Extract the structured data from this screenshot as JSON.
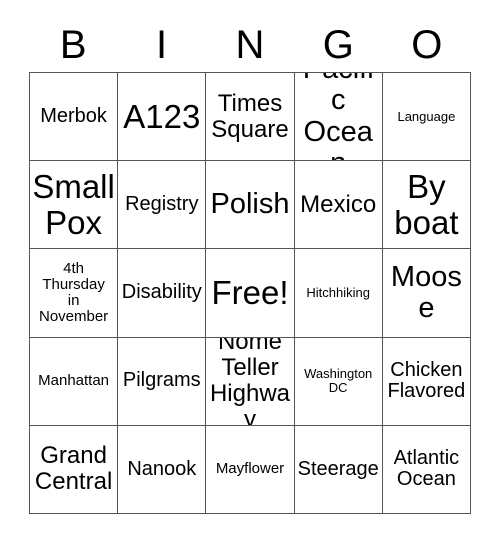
{
  "card": {
    "header": {
      "letters": [
        "B",
        "I",
        "N",
        "G",
        "O"
      ]
    },
    "grid": {
      "rows": 5,
      "columns": 5,
      "free_space_label": "Free!",
      "border_color": "#555555",
      "background_color": "#ffffff",
      "text_color": "#000000",
      "cells": [
        [
          {
            "text": "Merbok",
            "size": "s-md"
          },
          {
            "text": "A123",
            "size": "s-xxl"
          },
          {
            "text": "Times\nSquare",
            "size": "s-lg"
          },
          {
            "text": "Pacific\nOcean",
            "size": "s-xl"
          },
          {
            "text": "Language",
            "size": "s-xs"
          }
        ],
        [
          {
            "text": "Small\nPox",
            "size": "s-xxl"
          },
          {
            "text": "Registry",
            "size": "s-md"
          },
          {
            "text": "Polish",
            "size": "s-xl"
          },
          {
            "text": "Mexico",
            "size": "s-lg"
          },
          {
            "text": "By\nboat",
            "size": "s-xxl"
          }
        ],
        [
          {
            "text": "4th\nThursday\nin\nNovember",
            "size": "s-sm"
          },
          {
            "text": "Disability",
            "size": "s-md"
          },
          {
            "text": "Free!",
            "size": "s-xxl"
          },
          {
            "text": "Hitchhiking",
            "size": "s-xs"
          },
          {
            "text": "Moose",
            "size": "s-xl"
          }
        ],
        [
          {
            "text": "Manhattan",
            "size": "s-sm"
          },
          {
            "text": "Pilgrams",
            "size": "s-md"
          },
          {
            "text": "Nome\nTeller\nHighway",
            "size": "s-lg"
          },
          {
            "text": "Washington\nDC",
            "size": "s-xs"
          },
          {
            "text": "Chicken\nFlavored",
            "size": "s-md"
          }
        ],
        [
          {
            "text": "Grand\nCentral",
            "size": "s-lg"
          },
          {
            "text": "Nanook",
            "size": "s-md"
          },
          {
            "text": "Mayflower",
            "size": "s-sm"
          },
          {
            "text": "Steerage",
            "size": "s-md"
          },
          {
            "text": "Atlantic\nOcean",
            "size": "s-md"
          }
        ]
      ]
    }
  }
}
